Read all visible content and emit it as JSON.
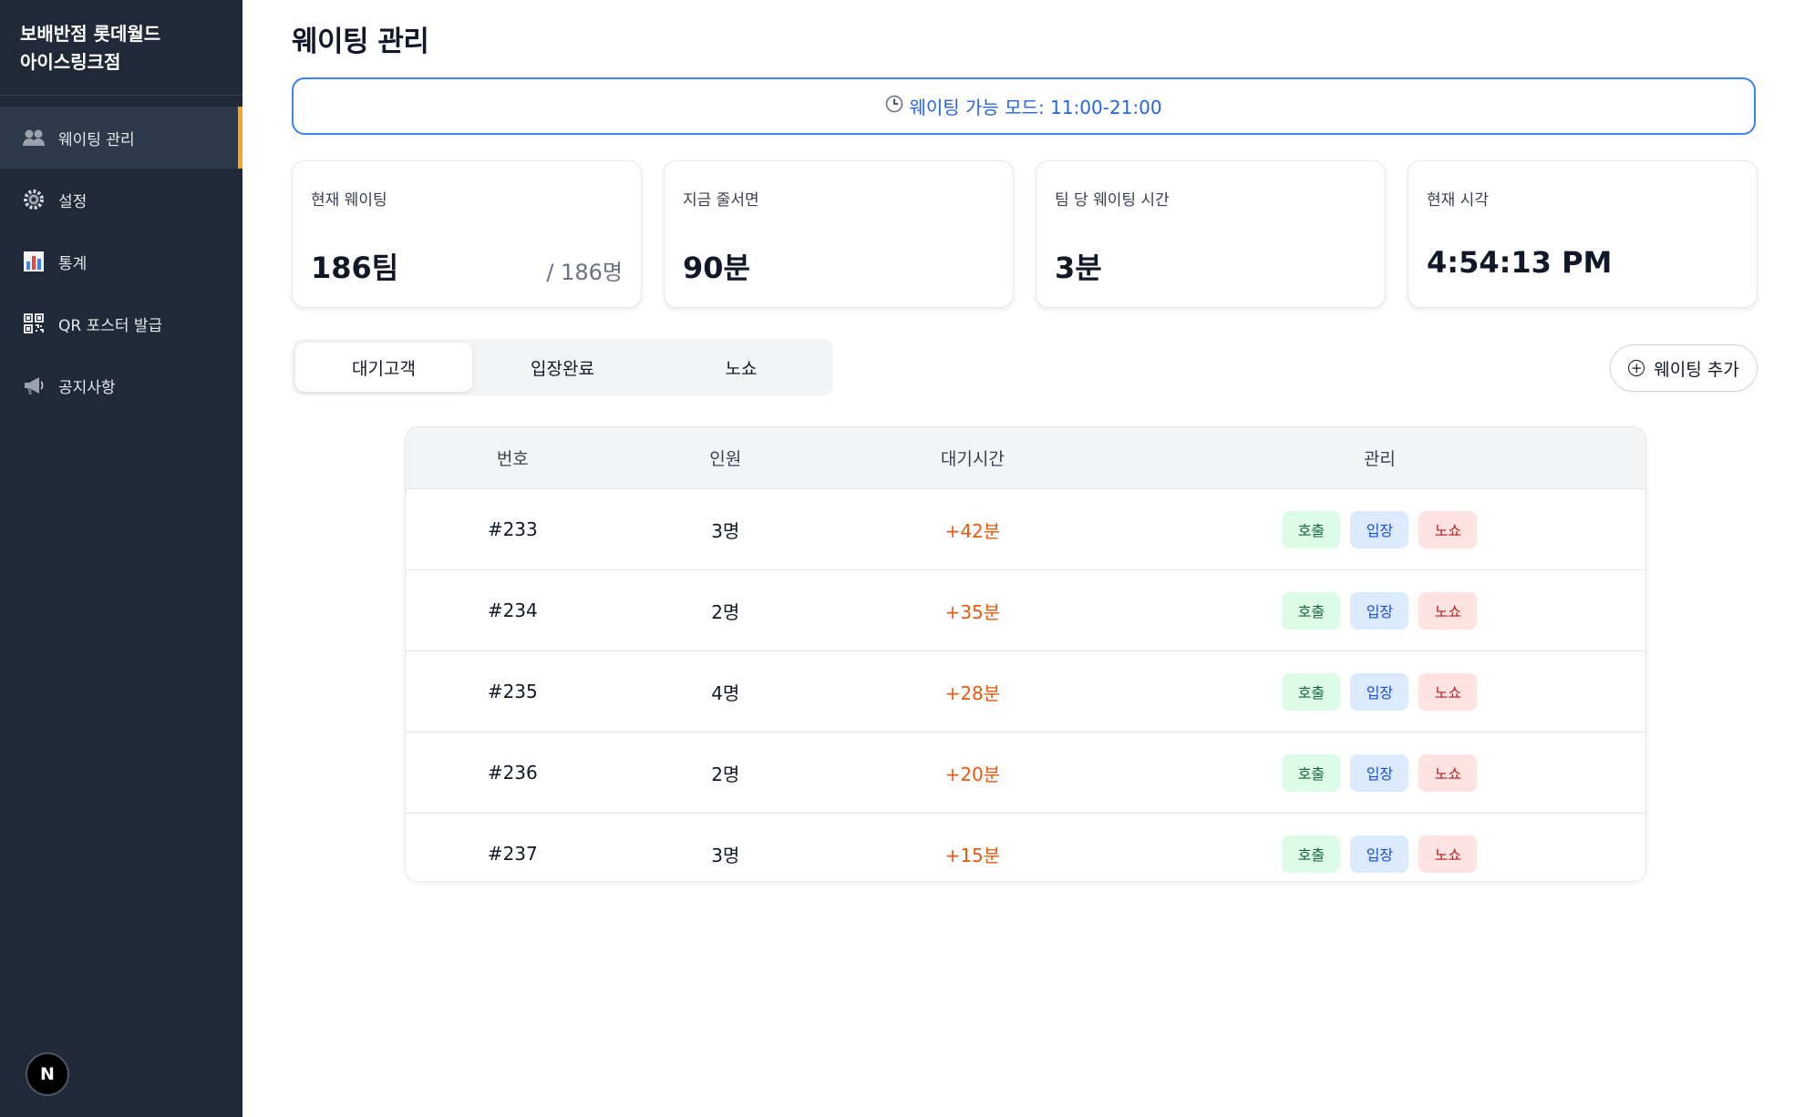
{
  "sidebar": {
    "store_line1": "보배반점 롯데월드",
    "store_line2": "아이스링크점",
    "items": [
      {
        "label": "웨이팅 관리",
        "icon": "users-icon",
        "active": true
      },
      {
        "label": "설정",
        "icon": "gear-icon"
      },
      {
        "label": "통계",
        "icon": "chart-icon"
      },
      {
        "label": "QR 포스터 발급",
        "icon": "qr-icon"
      },
      {
        "label": "공지사항",
        "icon": "megaphone-icon"
      }
    ],
    "badge_letter": "N"
  },
  "page": {
    "title": "웨이팅 관리",
    "mode_banner": "웨이팅 가능 모드: 11:00-21:00"
  },
  "stats": [
    {
      "label": "현재 웨이팅",
      "value": "186팀",
      "sub": "/ 186명"
    },
    {
      "label": "지금 줄서면",
      "value": "90분"
    },
    {
      "label": "팀 당 웨이팅 시간",
      "value": "3분"
    },
    {
      "label": "현재 시각",
      "value": "4:54:13 PM"
    }
  ],
  "tabs": [
    "대기고객",
    "입장완료",
    "노쇼"
  ],
  "add_button": "웨이팅 추가",
  "table": {
    "headers": [
      "번호",
      "인원",
      "대기시간",
      "관리"
    ],
    "actions": {
      "call": "호출",
      "enter": "입장",
      "noshow": "노쇼"
    },
    "rows": [
      {
        "number": "#233",
        "people": "3명",
        "wait": "+42분"
      },
      {
        "number": "#234",
        "people": "2명",
        "wait": "+35분"
      },
      {
        "number": "#235",
        "people": "4명",
        "wait": "+28분"
      },
      {
        "number": "#236",
        "people": "2명",
        "wait": "+20분"
      },
      {
        "number": "#237",
        "people": "3명",
        "wait": "+15분"
      }
    ]
  },
  "colors": {
    "accent": "#3b82f6",
    "sidebar": "#1f2937",
    "active_bar": "#f5a623",
    "wait_text": "#ea580c"
  }
}
